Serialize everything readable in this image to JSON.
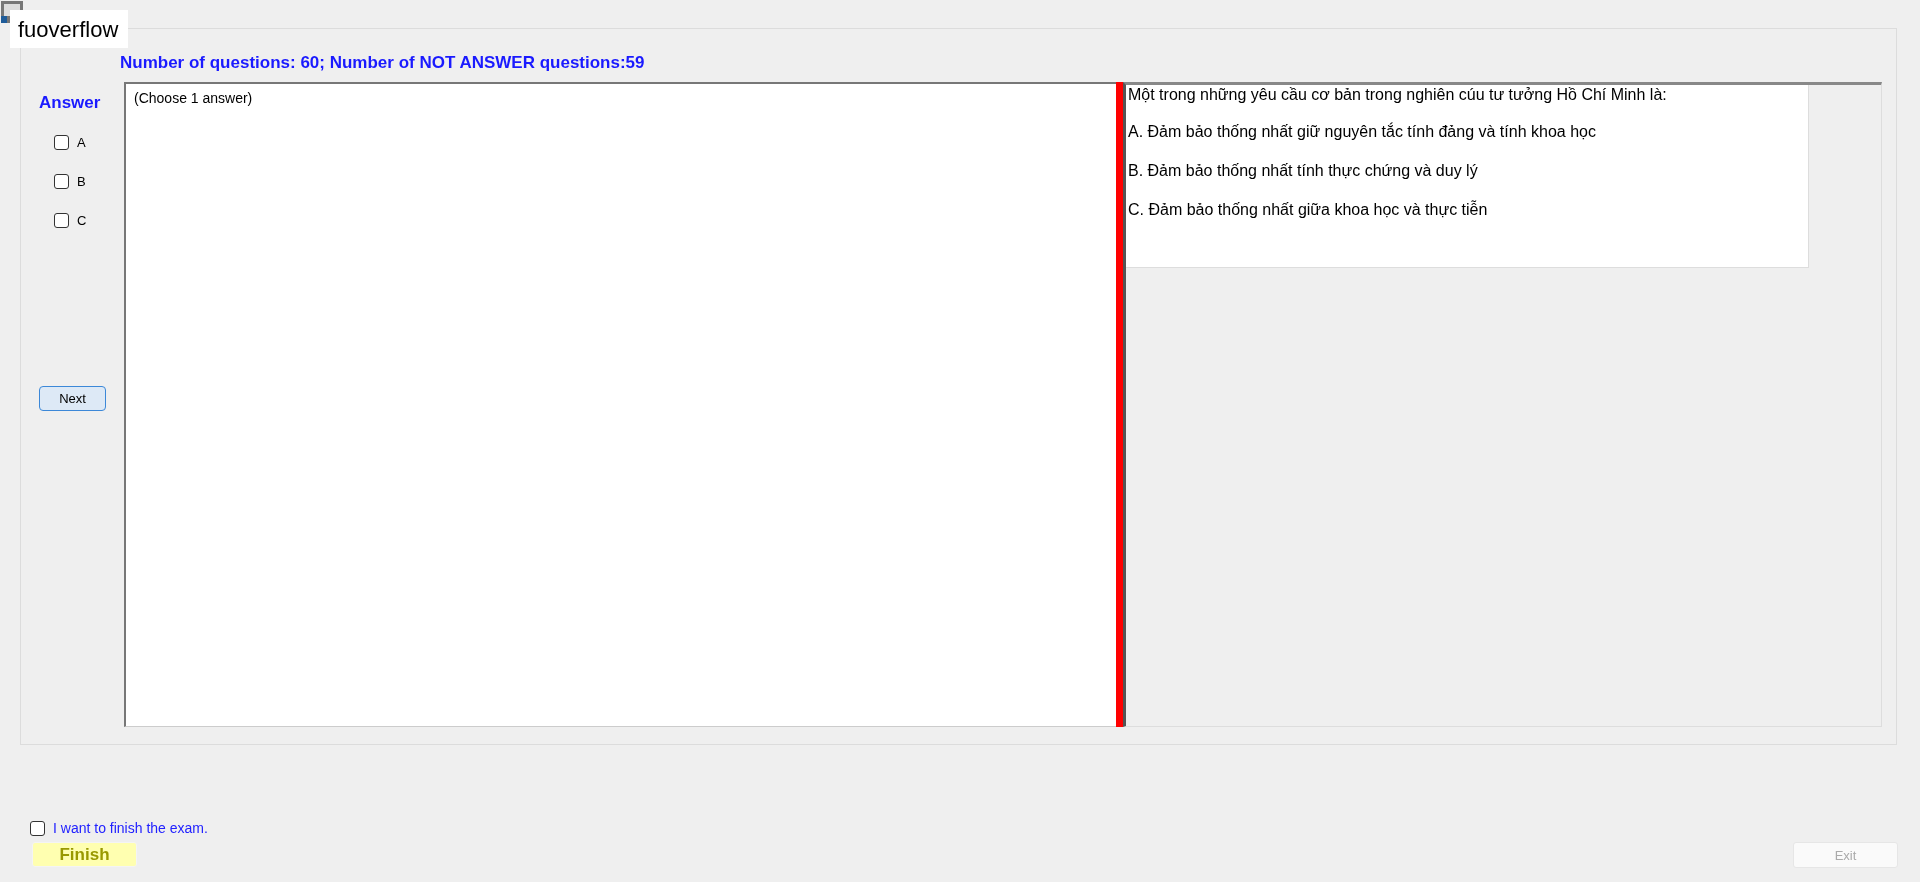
{
  "watermark_label": "fuoverflow",
  "header": "Number of questions: 60; Number of NOT ANSWER questions:59",
  "answer": {
    "title": "Answer",
    "options": [
      {
        "label": "A",
        "checked": false
      },
      {
        "label": "B",
        "checked": false
      },
      {
        "label": "C",
        "checked": false
      }
    ],
    "next_button": "Next"
  },
  "answer_pane": {
    "text": "(Choose 1 answer)"
  },
  "question": {
    "stem": "Một trong những yêu cầu cơ bản trong nghiên cúu tư tưởng Hồ Chí Minh là:",
    "choices": [
      "A.  Đảm bảo thống nhất giữ nguyên tắc tính đảng và tính khoa học",
      "B.  Đảm bảo thống nhất tính thực chứng và duy lý",
      "C.  Đảm bảo thống nhất giữa khoa học và thực tiễn"
    ]
  },
  "finish": {
    "confirm_label": "I want to finish the exam.",
    "checked": false,
    "finish_button": "Finish",
    "exit_button": "Exit",
    "exit_disabled": true
  }
}
